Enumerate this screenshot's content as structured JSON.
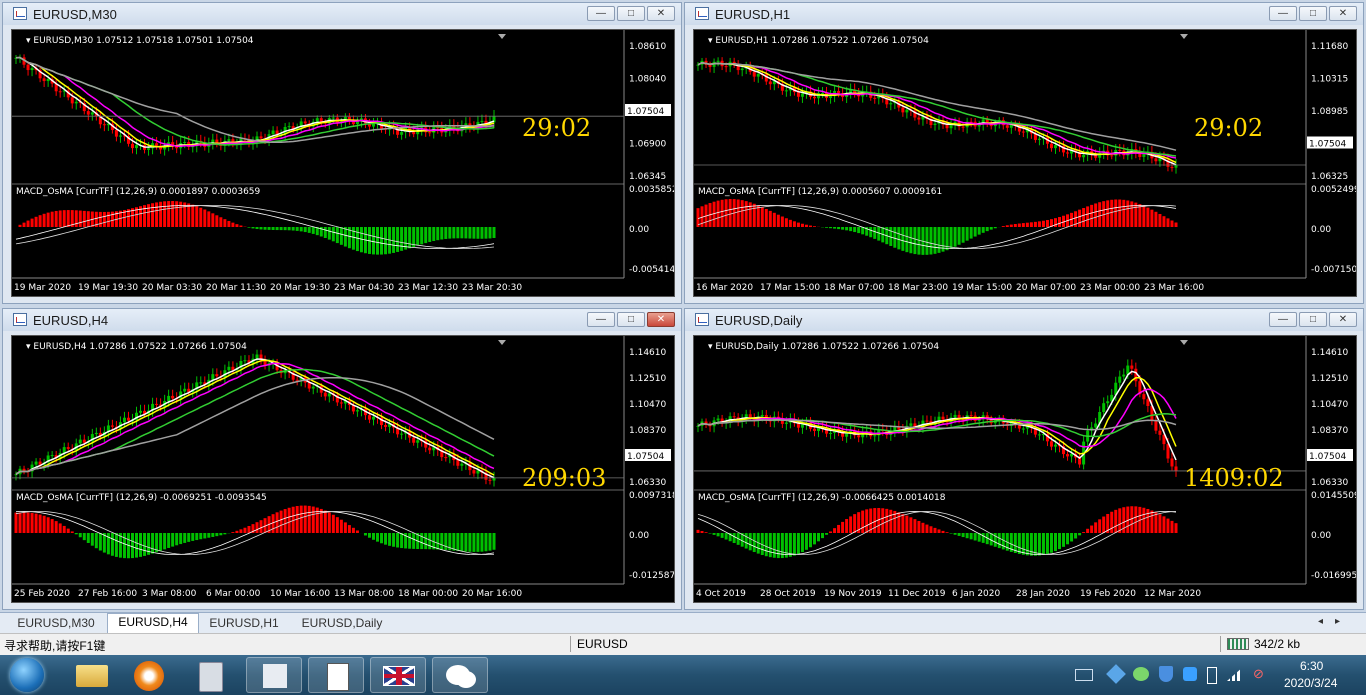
{
  "windows": [
    {
      "title": "EURUSD,M30",
      "info": "EURUSD,M30  1.07512 1.07518 1.07501 1.07504",
      "osma": "MACD_OsMA [CurrTF] (12,26,9) 0.0001897 0.0003659",
      "price_ticks": [
        "1.08610",
        "1.08040",
        "1.07504",
        "1.06900",
        "1.06345"
      ],
      "osma_ticks": [
        "0.0035852",
        "0.00",
        "-0.005414"
      ],
      "time_labels": [
        "19 Mar 2020",
        "19 Mar 19:30",
        "20 Mar 03:30",
        "20 Mar 11:30",
        "20 Mar 19:30",
        "23 Mar 04:30",
        "23 Mar 12:30",
        "23 Mar 20:30"
      ],
      "countdown": "29:02"
    },
    {
      "title": "EURUSD,H1",
      "info": "EURUSD,H1  1.07286 1.07522 1.07266 1.07504",
      "osma": "MACD_OsMA [CurrTF] (12,26,9) 0.0005607 0.0009161",
      "price_ticks": [
        "1.11680",
        "1.10315",
        "1.08985",
        "1.07504",
        "1.06325"
      ],
      "osma_ticks": [
        "0.0052499",
        "0.00",
        "-0.007150"
      ],
      "time_labels": [
        "16 Mar 2020",
        "17 Mar 15:00",
        "18 Mar 07:00",
        "18 Mar 23:00",
        "19 Mar 15:00",
        "20 Mar 07:00",
        "23 Mar 00:00",
        "23 Mar 16:00"
      ],
      "countdown": "29:02"
    },
    {
      "title": "EURUSD,H4",
      "info": "EURUSD,H4  1.07286 1.07522 1.07266 1.07504",
      "osma": "MACD_OsMA [CurrTF] (12,26,9) -0.0069251 -0.0093545",
      "price_ticks": [
        "1.14610",
        "1.12510",
        "1.10470",
        "1.08370",
        "1.07504",
        "1.06330"
      ],
      "osma_ticks": [
        "0.0097318",
        "0.00",
        "-0.012587"
      ],
      "time_labels": [
        "25 Feb 2020",
        "27 Feb 16:00",
        "3 Mar 08:00",
        "6 Mar 00:00",
        "10 Mar 16:00",
        "13 Mar 08:00",
        "18 Mar 00:00",
        "20 Mar 16:00"
      ],
      "countdown": "209:03"
    },
    {
      "title": "EURUSD,Daily",
      "info": "EURUSD,Daily  1.07286 1.07522 1.07266 1.07504",
      "osma": "MACD_OsMA [CurrTF] (12,26,9) -0.0066425 0.0014018",
      "price_ticks": [
        "1.14610",
        "1.12510",
        "1.10470",
        "1.08370",
        "1.07504",
        "1.06330"
      ],
      "osma_ticks": [
        "0.0145509",
        "0.00",
        "-0.016995"
      ],
      "time_labels": [
        "4 Oct 2019",
        "28 Oct 2019",
        "19 Nov 2019",
        "11 Dec 2019",
        "6 Jan 2020",
        "28 Jan 2020",
        "19 Feb 2020",
        "12 Mar 2020"
      ],
      "countdown": "1409:02"
    }
  ],
  "tabs": [
    "EURUSD,M30",
    "EURUSD,H4",
    "EURUSD,H1",
    "EURUSD,Daily"
  ],
  "active_tab": 1,
  "status": {
    "help": "寻求帮助,请按F1键",
    "symbol": "EURUSD",
    "traffic": "342/2 kb"
  },
  "clock": {
    "time": "6:30",
    "date": "2020/3/24"
  },
  "taskbar_icons": [
    "start-orb-icon",
    "file-explorer-icon",
    "browser-icon",
    "calculator-icon",
    "chart-app-icon",
    "notepad-icon",
    "flag-app-icon",
    "wechat-icon"
  ],
  "colors": {
    "bull": "#00c000",
    "bear": "#ff0000",
    "countdown": "#ffd700",
    "ma_white": "#ffffff",
    "ma_yellow": "#ffff00",
    "ma_magenta": "#ff00ff",
    "ma_green": "#32cd32",
    "ma_gray": "#a0a0a0"
  }
}
